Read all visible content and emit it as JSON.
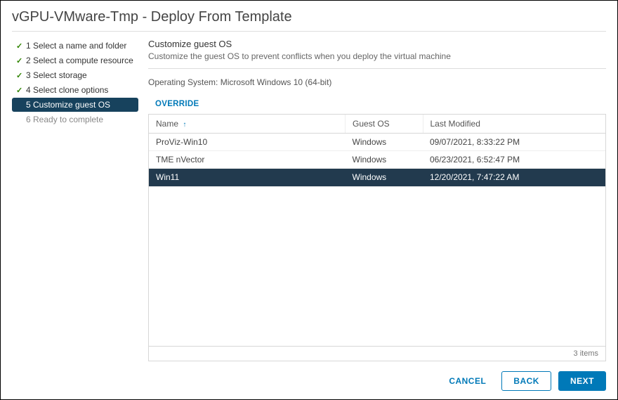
{
  "title": "vGPU-VMware-Tmp - Deploy From Template",
  "steps": [
    {
      "num": "1",
      "label": "Select a name and folder",
      "done": true
    },
    {
      "num": "2",
      "label": "Select a compute resource",
      "done": true
    },
    {
      "num": "3",
      "label": "Select storage",
      "done": true
    },
    {
      "num": "4",
      "label": "Select clone options",
      "done": true
    },
    {
      "num": "5",
      "label": "Customize guest OS",
      "active": true
    },
    {
      "num": "6",
      "label": "Ready to complete",
      "future": true
    }
  ],
  "section": {
    "title": "Customize guest OS",
    "desc": "Customize the guest OS to prevent conflicts when you deploy the virtual machine",
    "os_label": "Operating System:",
    "os_value": "Microsoft Windows 10 (64-bit)",
    "override": "OVERRIDE"
  },
  "table": {
    "headers": {
      "name": "Name",
      "os": "Guest OS",
      "modified": "Last Modified"
    },
    "rows": [
      {
        "name": "ProViz-Win10",
        "os": "Windows",
        "modified": "09/07/2021, 8:33:22 PM",
        "selected": false
      },
      {
        "name": "TME nVector",
        "os": "Windows",
        "modified": "06/23/2021, 6:52:47 PM",
        "selected": false
      },
      {
        "name": "Win11",
        "os": "Windows",
        "modified": "12/20/2021, 7:47:22 AM",
        "selected": true
      }
    ],
    "footer": "3 items"
  },
  "buttons": {
    "cancel": "CANCEL",
    "back": "BACK",
    "next": "NEXT"
  }
}
